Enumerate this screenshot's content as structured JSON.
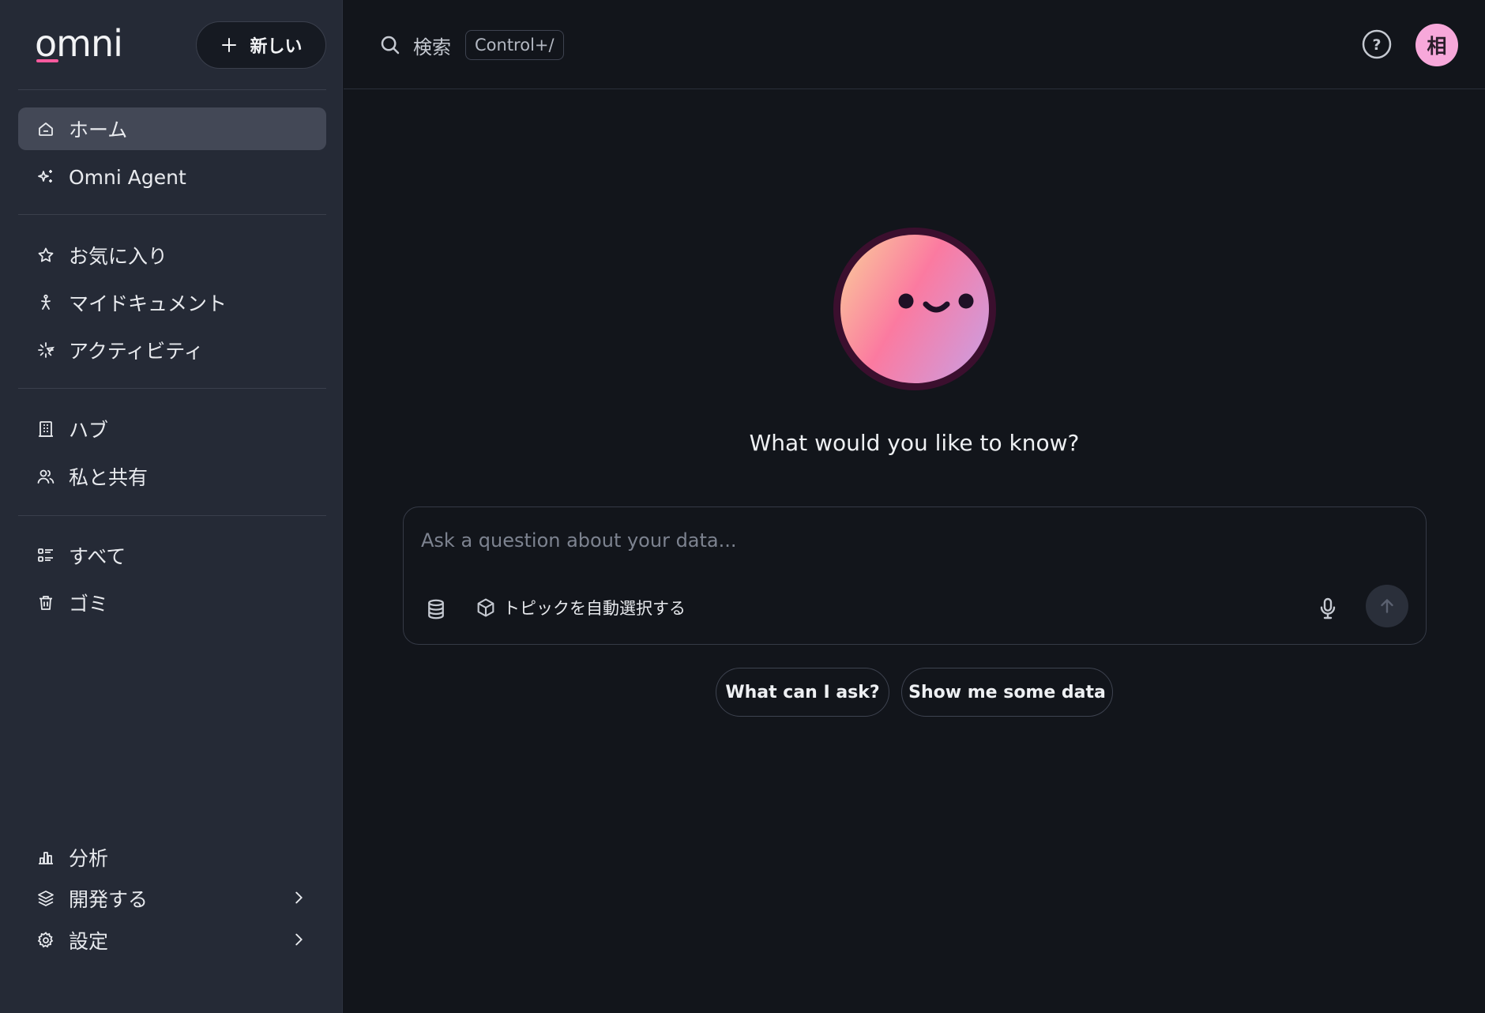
{
  "brand": {
    "logo_text": "omni",
    "accent": "#ff5a9e"
  },
  "sidebar": {
    "new_button_label": "新しい",
    "primary": [
      {
        "label": "ホーム",
        "icon": "home-icon",
        "active": true
      },
      {
        "label": "Omni Agent",
        "icon": "sparkles-icon"
      }
    ],
    "personal": [
      {
        "label": "お気に入り",
        "icon": "star-icon"
      },
      {
        "label": "マイドキュメント",
        "icon": "person-icon"
      },
      {
        "label": "アクティビティ",
        "icon": "activity-icon"
      }
    ],
    "shared": [
      {
        "label": "ハブ",
        "icon": "building-icon"
      },
      {
        "label": "私と共有",
        "icon": "users-icon"
      }
    ],
    "library": [
      {
        "label": "すべて",
        "icon": "list-icon"
      },
      {
        "label": "ゴミ",
        "icon": "trash-icon"
      }
    ],
    "bottom": [
      {
        "label": "分析",
        "icon": "bar-chart-icon"
      },
      {
        "label": "開発する",
        "icon": "layers-icon"
      },
      {
        "label": "設定",
        "icon": "gear-icon"
      }
    ]
  },
  "topbar": {
    "search_label": "検索",
    "search_shortcut": "Control+/",
    "avatar_initial": "相"
  },
  "main": {
    "headline": "What would you like to know?",
    "ask_placeholder": "Ask a question about your data...",
    "topic_label": "トピックを自動選択する",
    "suggestions": [
      "What can I ask?",
      "Show me some data"
    ]
  }
}
